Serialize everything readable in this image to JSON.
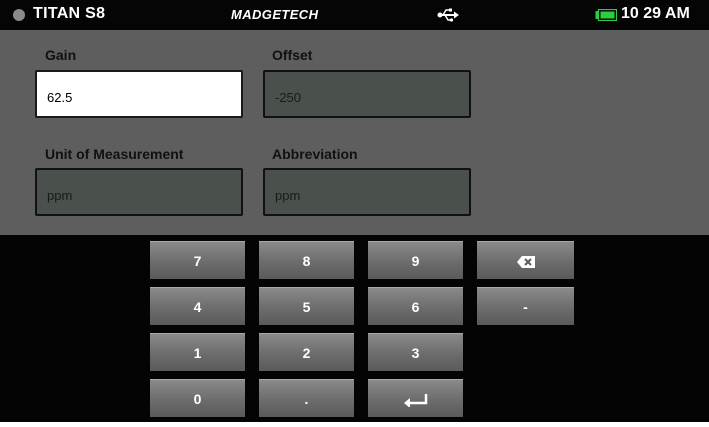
{
  "status_bar": {
    "device_name": "TITAN S8",
    "brand": "MADGETECH",
    "time": "10 29 AM",
    "usb_icon": "usb-icon",
    "battery_icon": "battery-icon",
    "battery_color": "#2ecc40"
  },
  "form": {
    "gain": {
      "label": "Gain",
      "value": "62.5"
    },
    "offset": {
      "label": "Offset",
      "value": "-250"
    },
    "unit": {
      "label": "Unit of Measurement",
      "value": "ppm"
    },
    "abbreviation": {
      "label": "Abbreviation",
      "value": "ppm"
    }
  },
  "keypad": {
    "k7": "7",
    "k8": "8",
    "k9": "9",
    "k4": "4",
    "k5": "5",
    "k6": "6",
    "k1": "1",
    "k2": "2",
    "k3": "3",
    "k0": "0",
    "dot": ".",
    "minus": "-",
    "backspace_icon": "backspace-icon",
    "enter_icon": "enter-icon"
  }
}
